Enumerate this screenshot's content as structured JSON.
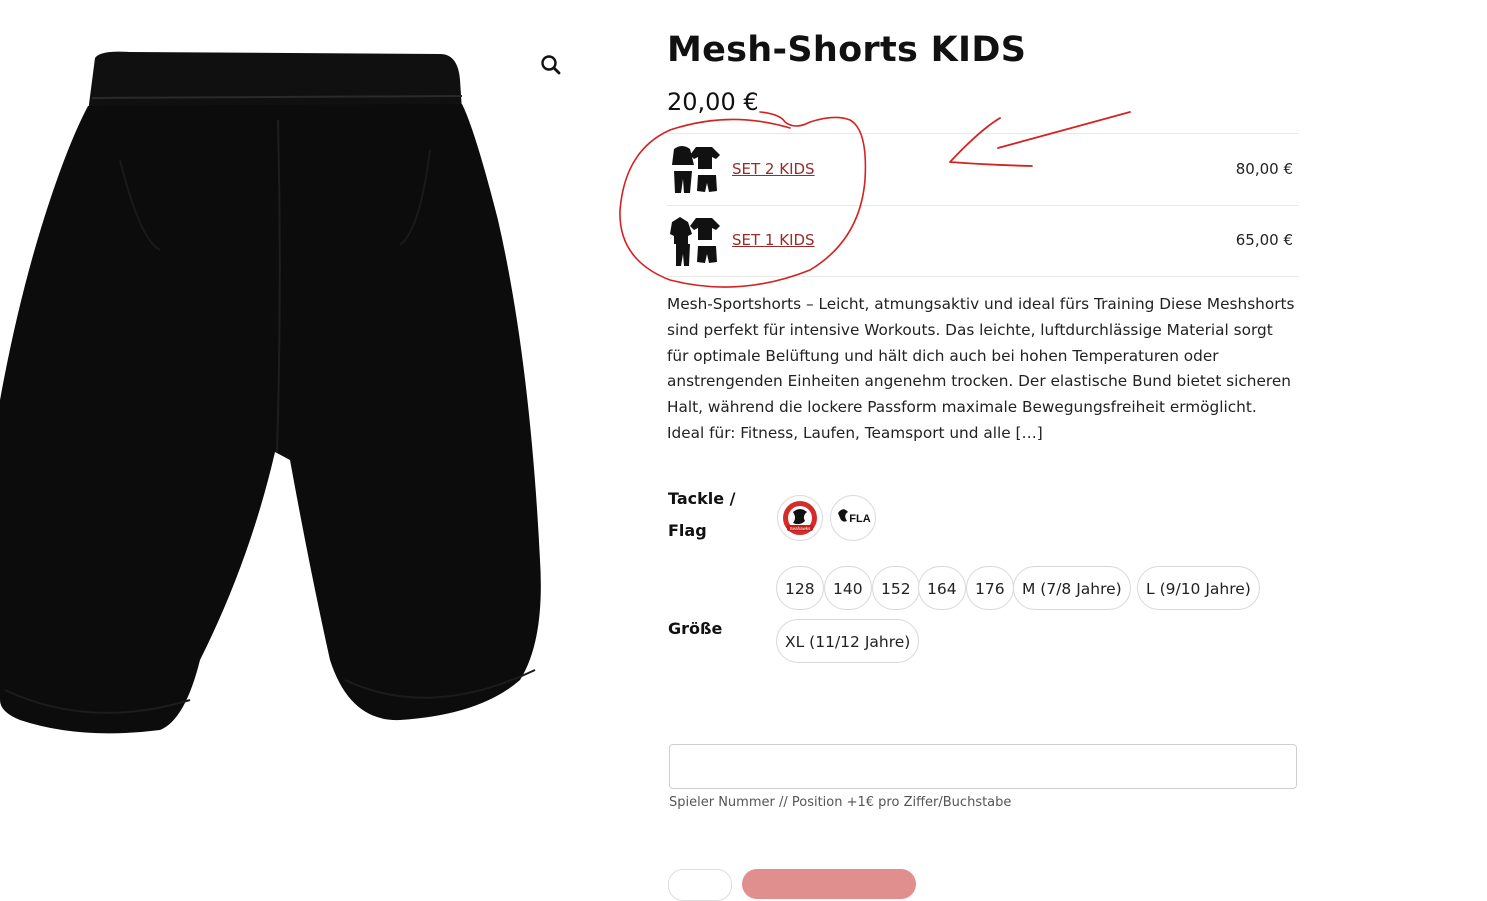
{
  "product": {
    "title": "Mesh-Shorts KIDS",
    "price": "20,00 €",
    "image_icon": "shorts-product-image",
    "zoom_icon": "magnifier-icon"
  },
  "sets": [
    {
      "label": "SET 2 KIDS",
      "price": "80,00 €",
      "icon": "set-bundle-thumbnail"
    },
    {
      "label": "SET 1 KIDS",
      "price": "65,00 €",
      "icon": "set-bundle-thumbnail"
    }
  ],
  "description": "Mesh-Sportshorts – Leicht, atmungsaktiv und ideal fürs Training Diese Meshshorts sind perfekt für intensive Workouts. Das leichte, luftdurchlässige Material sorgt für optimale Belüftung und hält dich auch bei hohen Temperaturen oder anstrengenden Einheiten angenehm trocken. Der elastische Bund bietet sicheren Halt, während die lockere Passform maximale Bewegungsfreiheit ermöglicht. Ideal für: Fitness, Laufen, Teamsport und alle […]",
  "attributes": {
    "tackle_flag": {
      "label_line1": "Tackle /",
      "label_line2": "Flag",
      "options": [
        {
          "icon": "tackle-team-logo",
          "logo_text": "Seahawks"
        },
        {
          "icon": "flag-team-logo",
          "logo_text": "FLA"
        }
      ]
    },
    "size": {
      "label": "Größe",
      "options": [
        "128",
        "140",
        "152",
        "164",
        "176",
        "M (7/8 Jahre)",
        "L (9/10 Jahre)",
        "XL (11/12 Jahre)"
      ]
    }
  },
  "player_number": {
    "value": "",
    "hint": "Spieler Nummer // Position +1€ pro Ziffer/Buchstabe"
  },
  "colors": {
    "link": "#9b2a2a",
    "annotation": "#d42222",
    "cart_button": "#e08e8e"
  }
}
